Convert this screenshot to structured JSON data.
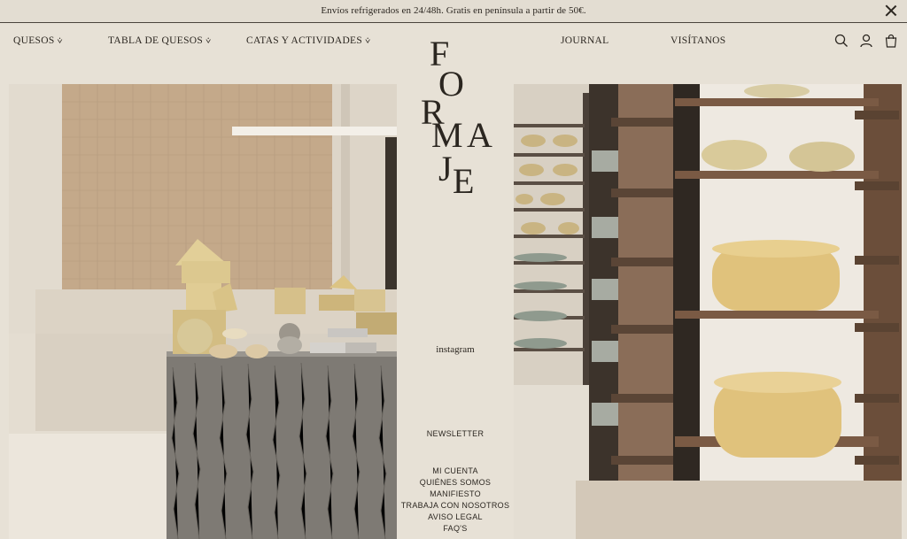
{
  "announcement": {
    "text": "Envíos refrigerados en 24/48h. Gratis en península a partir de 50€."
  },
  "nav": {
    "quesos": "QUESOS",
    "tabla": "TABLA DE QUESOS",
    "catas": "CATAS Y ACTIVIDADES",
    "journal": "JOURNAL",
    "visitanos": "VISÍTANOS"
  },
  "icons": [
    "search-icon",
    "account-icon",
    "bag-icon",
    "close-icon",
    "chevron-down-icon"
  ],
  "logo": {
    "letters": [
      "F",
      "O",
      "R",
      "M",
      "A",
      "J",
      "E"
    ]
  },
  "center": {
    "instagram": "instagram",
    "newsletter": "NEWSLETTER",
    "links": [
      "MI CUENTA",
      "QUIÉNES SOMOS",
      "MANIFIESTO",
      "TRABAJA CON NOSOTROS",
      "AVISO LEGAL",
      "FAQ'S"
    ]
  },
  "colors": {
    "background": "#e7e1d6",
    "text": "#2b2620"
  }
}
